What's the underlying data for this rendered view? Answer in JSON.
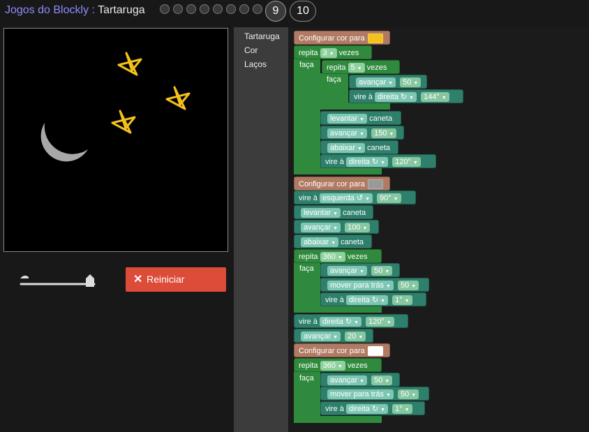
{
  "header": {
    "app_name": "Jogos do Blockly",
    "separator": " : ",
    "page_name": "Tartaruga",
    "levels": [
      "1",
      "2",
      "3",
      "4",
      "5",
      "6",
      "7",
      "8"
    ],
    "level_9": "9",
    "level_10": "10"
  },
  "controls": {
    "reset_label": "Reiniciar",
    "reset_icon": "close-icon",
    "speed_slider": {
      "min_icon": "turtle-icon",
      "max_icon": "rabbit-icon",
      "value": 0.82
    }
  },
  "toolbox": {
    "categories": [
      "Tartaruga",
      "Cor",
      "Laços"
    ]
  },
  "blocks": {
    "set_color": "Configurar cor para",
    "repeat": "repita",
    "times": "vezes",
    "do": "faça",
    "move_forward": "avançar",
    "move_backward": "mover para trás",
    "turn": "vire à",
    "right": "direita ↻",
    "left": "esquerda ↺",
    "pen_up": "levantar",
    "pen_down": "abaixar",
    "pen": "caneta",
    "v3": "3",
    "v5": "5",
    "v50": "50",
    "v144": "144°",
    "v150": "150",
    "v120": "120°",
    "v90": "90°",
    "v100": "100",
    "v360": "360",
    "v1": "1°",
    "v20": "20",
    "colors": {
      "yellow": "#f5c21b",
      "grey": "#999999",
      "white": "#ffffff",
      "star_stroke": "#f5c21b",
      "moon": "#a8a8a8"
    }
  }
}
